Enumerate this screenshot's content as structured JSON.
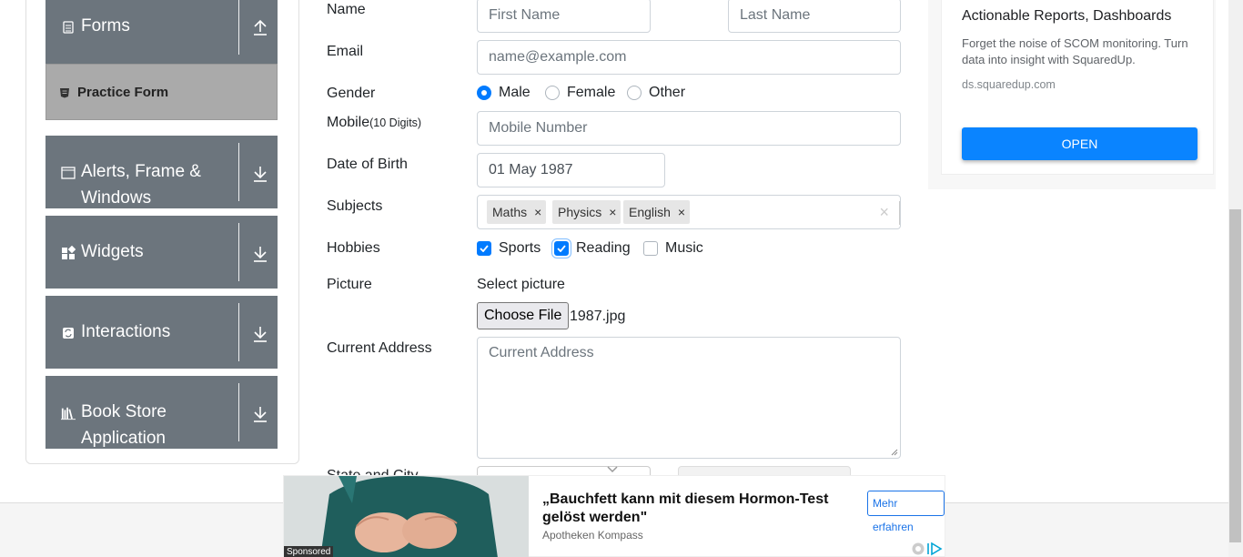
{
  "sidebar": {
    "groups": [
      {
        "label": "Forms",
        "icon": "document-icon",
        "arrow": "up"
      },
      {
        "label": "Alerts, Frame &",
        "label2": "Windows",
        "icon": "window-icon",
        "arrow": "down"
      },
      {
        "label": "Widgets",
        "icon": "widgets-icon",
        "arrow": "down"
      },
      {
        "label": "Interactions",
        "icon": "interactions-icon",
        "arrow": "down"
      },
      {
        "label": "Book Store",
        "label2": "Application",
        "icon": "books-icon",
        "arrow": "down"
      }
    ],
    "active_item": "Practice Form"
  },
  "form": {
    "name_label": "Name",
    "first_name_placeholder": "First Name",
    "last_name_placeholder": "Last Name",
    "email_label": "Email",
    "email_placeholder": "name@example.com",
    "gender_label": "Gender",
    "gender_options": [
      "Male",
      "Female",
      "Other"
    ],
    "gender_selected": "Male",
    "mobile_label": "Mobile",
    "mobile_hint": "(10 Digits)",
    "mobile_placeholder": "Mobile Number",
    "dob_label": "Date of Birth",
    "dob_value": "01 May 1987",
    "subjects_label": "Subjects",
    "subjects": [
      "Maths",
      "Physics",
      "English"
    ],
    "hobbies_label": "Hobbies",
    "hobbies": [
      {
        "label": "Sports",
        "checked": true
      },
      {
        "label": "Reading",
        "checked": true
      },
      {
        "label": "Music",
        "checked": false
      }
    ],
    "picture_label": "Picture",
    "select_picture": "Select picture",
    "choose_file_label": "Choose File",
    "file_name": "1987.jpg",
    "address_label": "Current Address",
    "address_placeholder": "Current Address",
    "state_city_label": "State and City"
  },
  "ad_right": {
    "title": "Actionable Reports, Dashboards",
    "description": "Forget the noise of SCOM monitoring. Turn data into insight with SquaredUp.",
    "url": "ds.squaredup.com",
    "button": "OPEN"
  },
  "ad_bottom": {
    "sponsored": "Sponsored",
    "headline": "„Bauchfett kann mit diesem Hormon-Test gelöst werden\"",
    "source": "Apotheken Kompass",
    "button": "Mehr erfahren"
  },
  "colors": {
    "sidebar_group": "#6c757d",
    "sidebar_active": "#aaaaaa",
    "accent": "#007bff",
    "ad_button": "#0a84ff"
  }
}
